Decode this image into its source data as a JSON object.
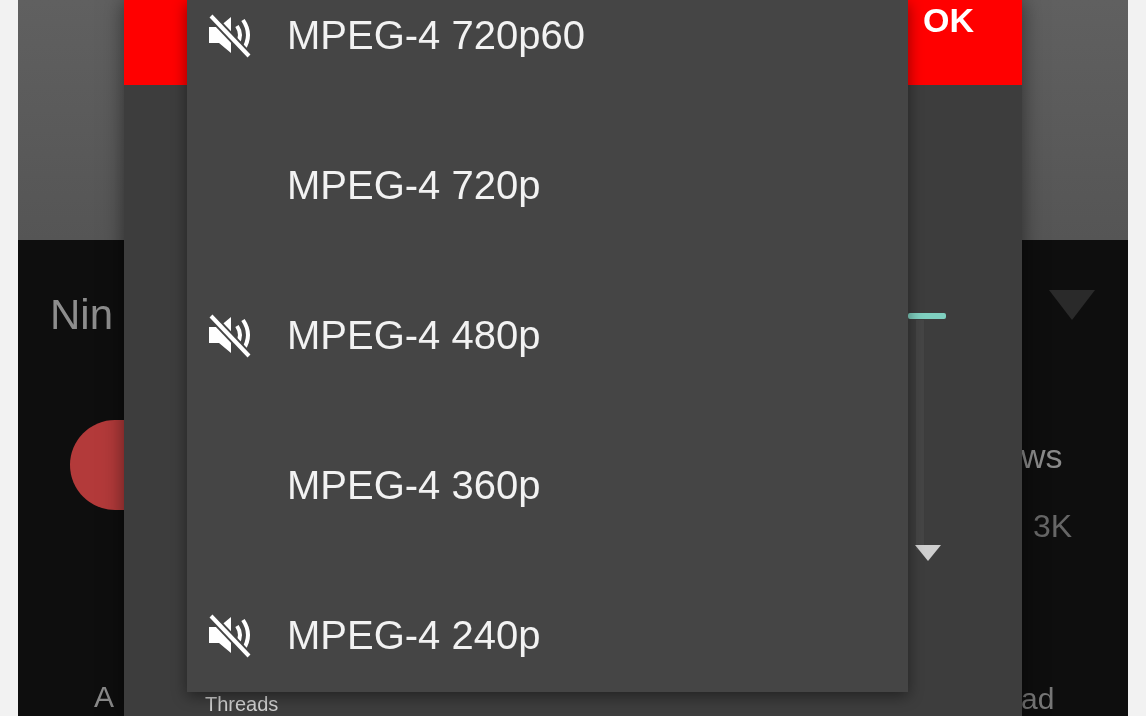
{
  "background": {
    "title_fragment": "Nin",
    "stats_label_fragment": "ws",
    "stats_value_fragment": "3K",
    "bottom_left_fragment": "A",
    "bottom_right_fragment": "ad"
  },
  "dialog": {
    "confirm_button": "OK",
    "bottom_label": "Threads",
    "options": [
      {
        "label": "MPEG-4 720p60",
        "muted": true
      },
      {
        "label": "MPEG-4 720p",
        "muted": false
      },
      {
        "label": "MPEG-4 480p",
        "muted": true
      },
      {
        "label": "MPEG-4 360p",
        "muted": false
      },
      {
        "label": "MPEG-4 240p",
        "muted": true
      }
    ]
  }
}
